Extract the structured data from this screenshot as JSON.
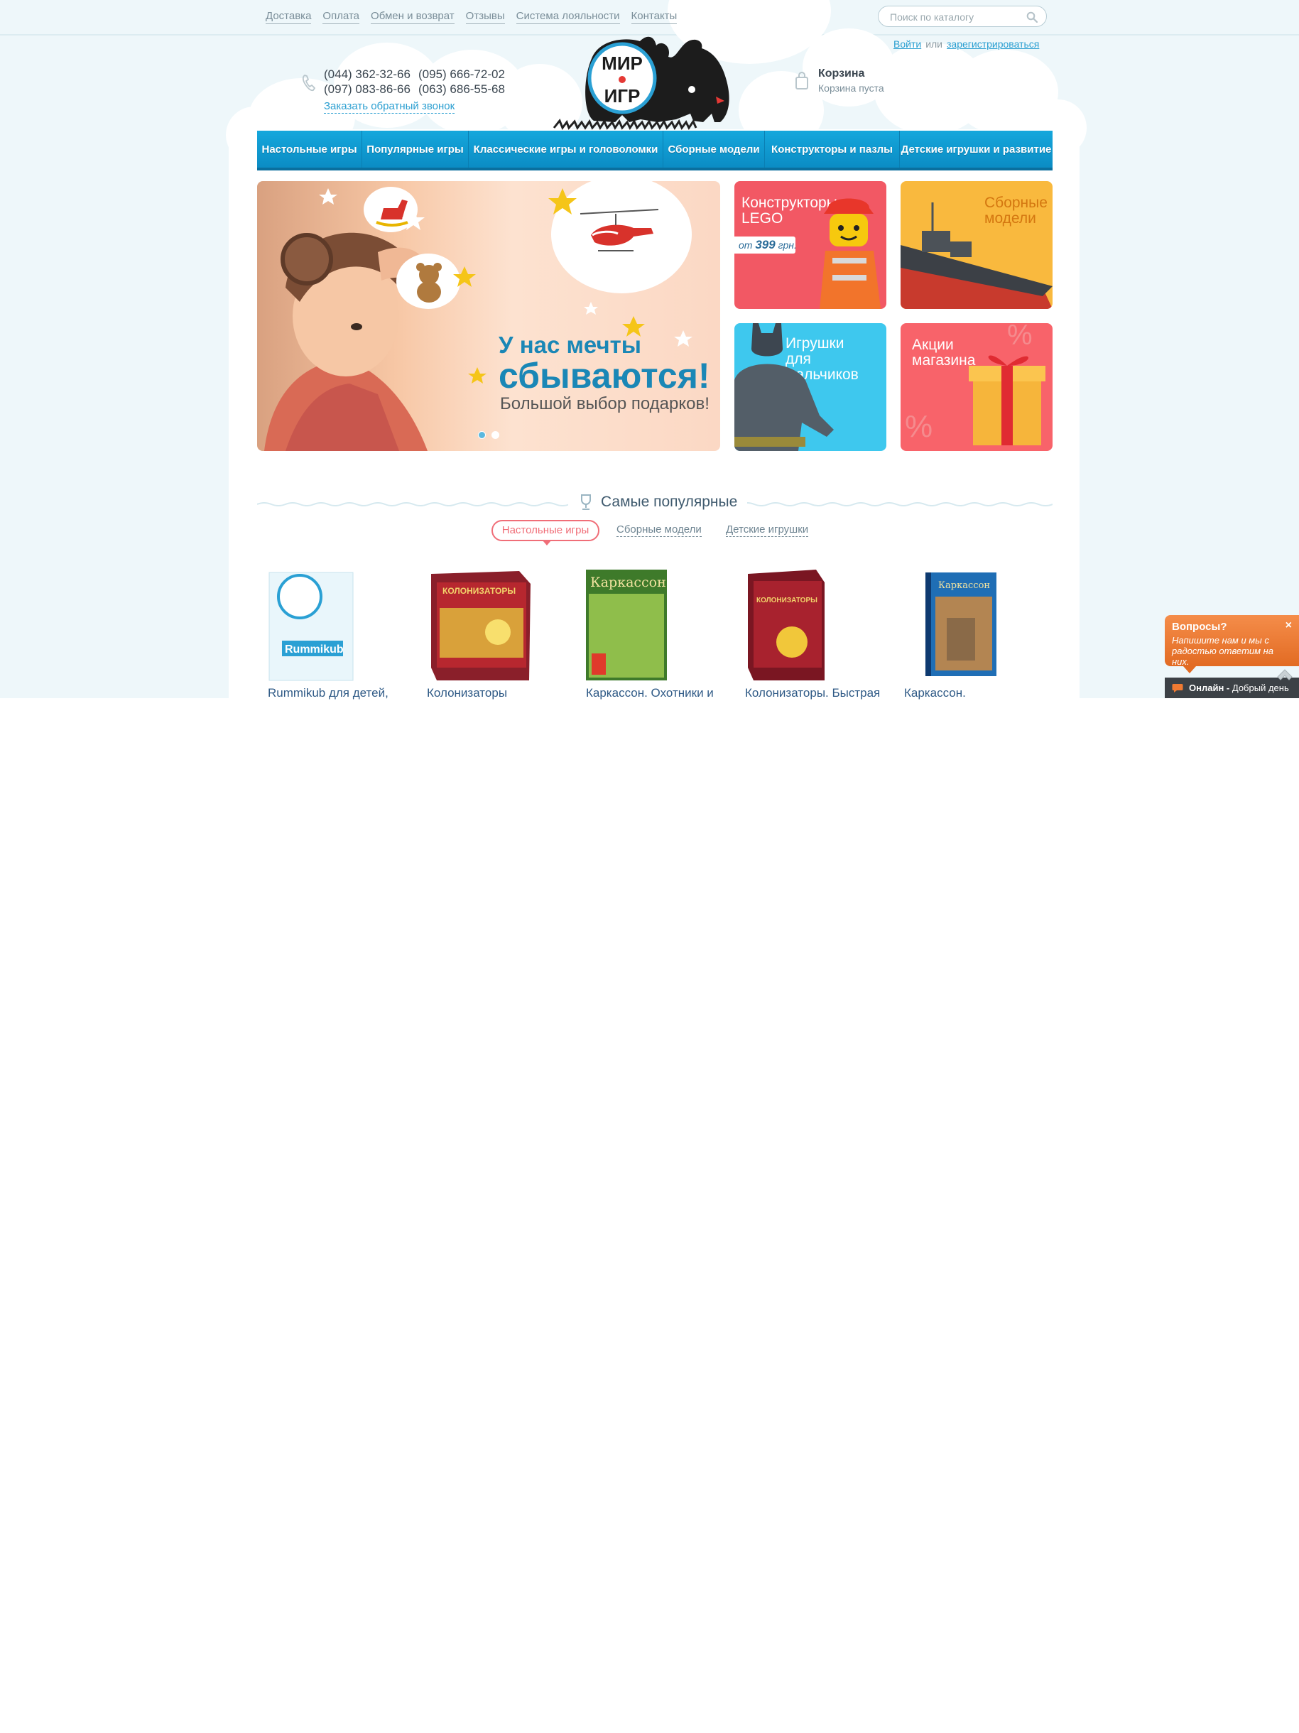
{
  "top_nav": [
    "Доставка",
    "Оплата",
    "Обмен и возврат",
    "Отзывы",
    "Система лояльности",
    "Контакты"
  ],
  "search": {
    "placeholder": "Поиск по каталогу"
  },
  "auth": {
    "login": "Войти",
    "or": "или",
    "register": "зарегистрироваться"
  },
  "phones": {
    "p1": "(044) 362-32-66",
    "p2": "(095) 666-72-02",
    "p3": "(097) 083-86-66",
    "p4": "(063) 686-55-68"
  },
  "callback": "Заказать обратный звонок",
  "logo": {
    "line1": "МИР",
    "line2": "ИГР"
  },
  "cart": {
    "title": "Корзина",
    "status": "Корзина пуста"
  },
  "menu": [
    "Настольные игры",
    "Популярные игры",
    "Классические игры и головоломки",
    "Сборные модели",
    "Конструкторы и пазлы",
    "Детские игрушки и развитие"
  ],
  "slider": {
    "line1": "У нас мечты",
    "line2": "сбываются!",
    "line3": "Большой выбор подарков!",
    "slides": 2,
    "active_slide": 1
  },
  "tiles": {
    "lego": {
      "label": "Конструкторы\nLEGO",
      "price_prefix": "от",
      "price": "399",
      "price_suffix": "грн."
    },
    "models": {
      "label": "Сборные\nмодели"
    },
    "boys": {
      "label": "Игрушки\nдля мальчиков"
    },
    "sale": {
      "label": "Акции\nмагазина"
    }
  },
  "popular": {
    "title": "Самые популярные",
    "tabs": [
      "Настольные игры",
      "Сборные модели",
      "Детские игрушки"
    ],
    "active_tab": 0,
    "products": [
      {
        "name": "Rummikub для детей,"
      },
      {
        "name": "Колонизаторы"
      },
      {
        "name": "Каркассон. Охотники и"
      },
      {
        "name": "Колонизаторы. Быстрая"
      },
      {
        "name": "Каркассон."
      }
    ]
  },
  "chat": {
    "title": "Вопросы?",
    "text": "Напишите нам и мы с радостью ответим на них.",
    "close": "×",
    "status_bold": "Онлайн -",
    "status_text": "Добрый день"
  },
  "colors": {
    "accent_blue": "#0b8cc4",
    "accent_pink": "#f06e78",
    "chat_orange": "#e26b23",
    "sky": "#eef7fa"
  }
}
